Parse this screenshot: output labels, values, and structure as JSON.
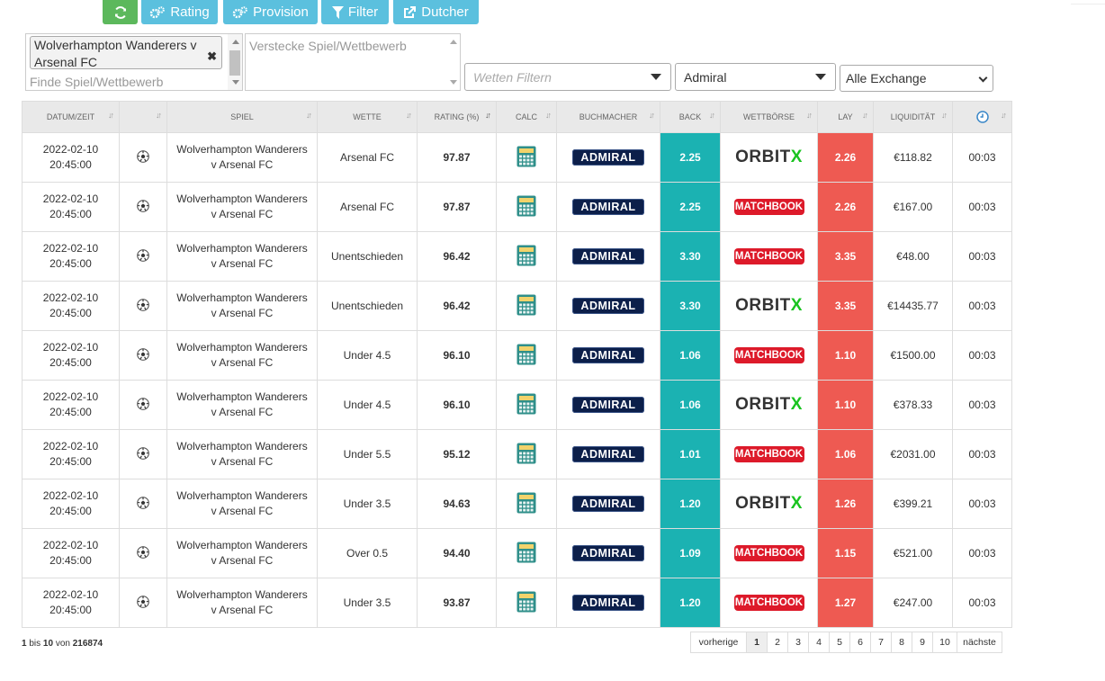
{
  "toolbar": {
    "refresh_icon": "refresh-icon",
    "rating": "Rating",
    "provision": "Provision",
    "filter": "Filter",
    "dutcher": "Dutcher"
  },
  "filters": {
    "selected_match": "Wolverhampton Wanderers v Arsenal FC",
    "match_placeholder": "Finde Spiel/Wettbewerb",
    "hide_placeholder": "Verstecke Spiel/Wettbewerb",
    "bets_placeholder": "Wetten Filtern",
    "bookmaker": "Admiral",
    "exchange": "Alle Exchange"
  },
  "columns": [
    "Datum/Zeit",
    "",
    "Spiel",
    "Wette",
    "Rating (%)",
    "Calc",
    "Buchmacher",
    "Back",
    "Wettbörse",
    "Lay",
    "Liquidität",
    ""
  ],
  "rows": [
    {
      "date": "2022-02-10",
      "time": "20:45:00",
      "game1": "Wolverhampton Wanderers",
      "game2": "v Arsenal FC",
      "bet": "Arsenal FC",
      "rating": "97.87",
      "bookmaker": "ADMIRAL",
      "back": "2.25",
      "exchange": "ORBITX",
      "lay": "2.26",
      "liquidity": "€118.82",
      "age": "00:03"
    },
    {
      "date": "2022-02-10",
      "time": "20:45:00",
      "game1": "Wolverhampton Wanderers",
      "game2": "v Arsenal FC",
      "bet": "Arsenal FC",
      "rating": "97.87",
      "bookmaker": "ADMIRAL",
      "back": "2.25",
      "exchange": "MATCHBOOK",
      "lay": "2.26",
      "liquidity": "€167.00",
      "age": "00:03"
    },
    {
      "date": "2022-02-10",
      "time": "20:45:00",
      "game1": "Wolverhampton Wanderers",
      "game2": "v Arsenal FC",
      "bet": "Unentschieden",
      "rating": "96.42",
      "bookmaker": "ADMIRAL",
      "back": "3.30",
      "exchange": "MATCHBOOK",
      "lay": "3.35",
      "liquidity": "€48.00",
      "age": "00:03"
    },
    {
      "date": "2022-02-10",
      "time": "20:45:00",
      "game1": "Wolverhampton Wanderers",
      "game2": "v Arsenal FC",
      "bet": "Unentschieden",
      "rating": "96.42",
      "bookmaker": "ADMIRAL",
      "back": "3.30",
      "exchange": "ORBITX",
      "lay": "3.35",
      "liquidity": "€14435.77",
      "age": "00:03"
    },
    {
      "date": "2022-02-10",
      "time": "20:45:00",
      "game1": "Wolverhampton Wanderers",
      "game2": "v Arsenal FC",
      "bet": "Under 4.5",
      "rating": "96.10",
      "bookmaker": "ADMIRAL",
      "back": "1.06",
      "exchange": "MATCHBOOK",
      "lay": "1.10",
      "liquidity": "€1500.00",
      "age": "00:03"
    },
    {
      "date": "2022-02-10",
      "time": "20:45:00",
      "game1": "Wolverhampton Wanderers",
      "game2": "v Arsenal FC",
      "bet": "Under 4.5",
      "rating": "96.10",
      "bookmaker": "ADMIRAL",
      "back": "1.06",
      "exchange": "ORBITX",
      "lay": "1.10",
      "liquidity": "€378.33",
      "age": "00:03"
    },
    {
      "date": "2022-02-10",
      "time": "20:45:00",
      "game1": "Wolverhampton Wanderers",
      "game2": "v Arsenal FC",
      "bet": "Under 5.5",
      "rating": "95.12",
      "bookmaker": "ADMIRAL",
      "back": "1.01",
      "exchange": "MATCHBOOK",
      "lay": "1.06",
      "liquidity": "€2031.00",
      "age": "00:03"
    },
    {
      "date": "2022-02-10",
      "time": "20:45:00",
      "game1": "Wolverhampton Wanderers",
      "game2": "v Arsenal FC",
      "bet": "Under 3.5",
      "rating": "94.63",
      "bookmaker": "ADMIRAL",
      "back": "1.20",
      "exchange": "ORBITX",
      "lay": "1.26",
      "liquidity": "€399.21",
      "age": "00:03"
    },
    {
      "date": "2022-02-10",
      "time": "20:45:00",
      "game1": "Wolverhampton Wanderers",
      "game2": "v Arsenal FC",
      "bet": "Over 0.5",
      "rating": "94.40",
      "bookmaker": "ADMIRAL",
      "back": "1.09",
      "exchange": "MATCHBOOK",
      "lay": "1.15",
      "liquidity": "€521.00",
      "age": "00:03"
    },
    {
      "date": "2022-02-10",
      "time": "20:45:00",
      "game1": "Wolverhampton Wanderers",
      "game2": "v Arsenal FC",
      "bet": "Under 3.5",
      "rating": "93.87",
      "bookmaker": "ADMIRAL",
      "back": "1.20",
      "exchange": "MATCHBOOK",
      "lay": "1.27",
      "liquidity": "€247.00",
      "age": "00:03"
    }
  ],
  "info": {
    "from": "1",
    "bis": "bis",
    "to": "10",
    "von": "von",
    "total": "216874"
  },
  "pagination": {
    "prev": "vorherige",
    "pages": [
      "1",
      "2",
      "3",
      "4",
      "5",
      "6",
      "7",
      "8",
      "9",
      "10"
    ],
    "active": "1",
    "next": "nächste"
  },
  "colors": {
    "back": "#1bb2b2",
    "lay": "#ee5a52",
    "green_button": "#5cb85c",
    "blue_button": "#5bc0de",
    "admiral": "#0c1f4a",
    "matchbook": "#dd1a2a",
    "orbitx_x": "#19c31f"
  }
}
